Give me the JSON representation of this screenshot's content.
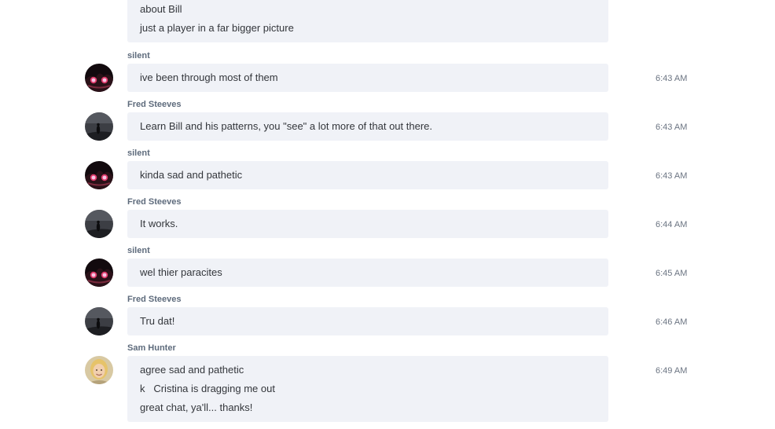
{
  "messages": [
    {
      "sender": "",
      "avatar": "none",
      "time": "",
      "lines": [
        "about Bill",
        "just a player in a far bigger picture"
      ]
    },
    {
      "sender": "silent",
      "avatar": "anime-avatar",
      "time": "6:43 AM",
      "lines": [
        "ive been through most of them"
      ]
    },
    {
      "sender": "Fred Steeves",
      "avatar": "silhouette-avatar",
      "time": "6:43 AM",
      "lines": [
        "Learn Bill and his patterns, you \"see\" a lot more of that out there."
      ]
    },
    {
      "sender": "silent",
      "avatar": "anime-avatar",
      "time": "6:43 AM",
      "lines": [
        "kinda sad and pathetic"
      ]
    },
    {
      "sender": "Fred Steeves",
      "avatar": "silhouette-avatar",
      "time": "6:44 AM",
      "lines": [
        "It works."
      ]
    },
    {
      "sender": "silent",
      "avatar": "anime-avatar",
      "time": "6:45 AM",
      "lines": [
        "wel thier paracites"
      ]
    },
    {
      "sender": "Fred Steeves",
      "avatar": "silhouette-avatar",
      "time": "6:46 AM",
      "lines": [
        "Tru dat!"
      ]
    },
    {
      "sender": "Sam Hunter",
      "avatar": "blonde-avatar",
      "time": "6:49 AM",
      "lines": [
        "agree sad and pathetic",
        "k   Cristina is dragging me out",
        "great chat, ya'll... thanks!"
      ]
    }
  ],
  "colors": {
    "bubble": "#f0f2f7",
    "sender": "#5e6b7c",
    "text": "#33363b",
    "time": "#6b7482"
  }
}
